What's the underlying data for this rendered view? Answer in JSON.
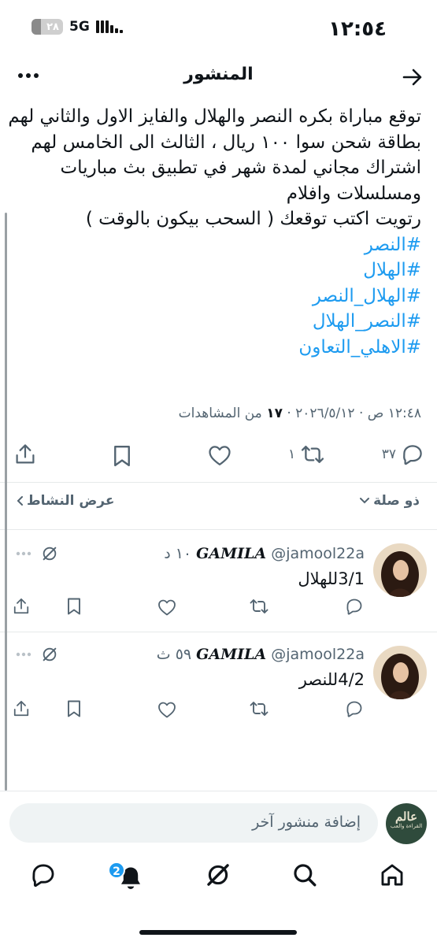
{
  "status_bar": {
    "time": "١٢:٥٤",
    "network": "5G",
    "battery": "٢٨"
  },
  "header": {
    "title": "المنشور"
  },
  "post": {
    "lines": [
      "توقع مباراة بكره النصر والهلال والفايز الاول والثاني لهم",
      "بطاقة شحن سوا ١٠٠ ريال ، الثالث الى  الخامس لهم",
      "اشتراك مجاني لمدة شهر في تطبيق بث مباريات",
      "ومسلسلات وافلام",
      "رتويت اكتب توقعك ( السحب بيكون بالوقت )"
    ],
    "hashtags": [
      "#النصر",
      "#الهلال",
      "#الهلال_النصر",
      "#النصر_الهلال",
      "#الاهلي_التعاون"
    ],
    "time": "١٢:٤٨ ص",
    "date": "٢٠٢٦/٥/١٢",
    "views_count": "١٧",
    "views_label": "من المشاهدات",
    "reply_count": "٣٧",
    "repost_count": "١"
  },
  "sort": {
    "relevance": "ذو صلة",
    "view_activity": "عرض النشاط"
  },
  "replies": [
    {
      "name": "GAMILA",
      "handle": "@jamool22a",
      "time": "١٠ د",
      "text": "3/1للهلال"
    },
    {
      "name": "GAMILA",
      "handle": "@jamool22a",
      "time": "٥٩ ث",
      "text": "4/2للنصر"
    }
  ],
  "compose": {
    "placeholder": "إضافة منشور آخر",
    "avatar_text_top": "عالم",
    "avatar_text_bottom": "القراءة والعب"
  },
  "tab_bar": {
    "notifications_badge": "2"
  },
  "colors": {
    "accent": "#1d9bf0",
    "text": "#0f1419",
    "secondary": "#536471"
  }
}
